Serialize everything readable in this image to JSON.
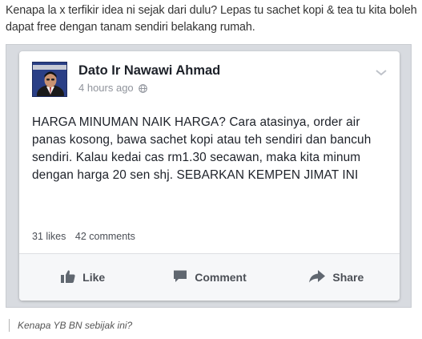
{
  "caption_top": "Kenapa la x terfikir idea ni sejak dari dulu? Lepas tu sachet kopi & tea tu kita boleh dapat free dengan tanam sendiri belakang rumah.",
  "post": {
    "author": "Dato Ir Nawawi Ahmad",
    "time": "4 hours ago",
    "body": "HARGA MINUMAN NAIK HARGA? Cara atasinya, order air panas kosong, bawa sachet kopi atau teh sendiri dan bancuh sendiri. Kalau kedai cas rm1.30 secawan, maka kita minum dengan harga 20 sen shj. SEBARKAN KEMPEN JIMAT INI",
    "likes": "31 likes",
    "comments": "42 comments",
    "actions": {
      "like": "Like",
      "comment": "Comment",
      "share": "Share"
    }
  },
  "icons": {
    "time": "globe-icon",
    "menu": "chevron-down-icon",
    "like": "thumbs-up-icon",
    "comment": "comment-icon",
    "share": "share-arrow-icon"
  },
  "caption_bottom": "Kenapa YB BN sebijak ini?"
}
